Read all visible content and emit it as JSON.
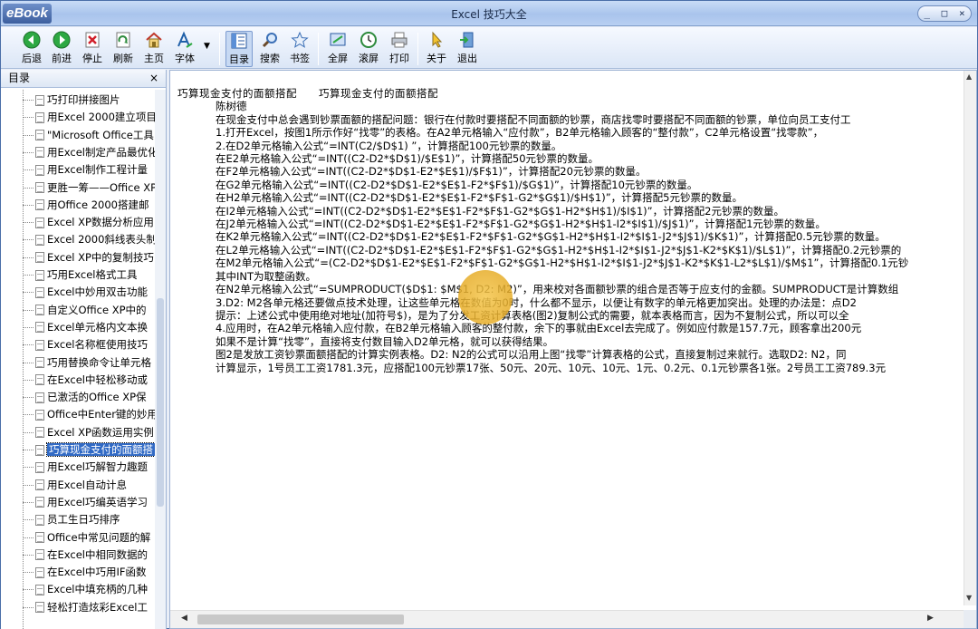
{
  "app": {
    "logo": "eBook",
    "title": "Excel 技巧大全"
  },
  "window_controls": {
    "minimize": "_",
    "maximize": "□",
    "close": "×"
  },
  "toolbar": {
    "back": "后退",
    "forward": "前进",
    "stop": "停止",
    "refresh": "刷新",
    "home": "主页",
    "font": "字体",
    "toc": "目录",
    "search": "搜索",
    "bookmark": "书签",
    "fullscreen": "全屏",
    "scroll": "滚屏",
    "print": "打印",
    "about": "关于",
    "exit": "退出"
  },
  "sidebar": {
    "title": "目录",
    "close": "×",
    "items": [
      "巧打印拼接图片",
      "用Excel 2000建立项目",
      "\"Microsoft Office工具",
      "用Excel制定产品最优化",
      "用Excel制作工程计量",
      "更胜一筹——Office XP",
      "用Office 2000搭建邮",
      "Excel XP数据分析应用",
      "Excel 2000斜线表头制",
      "Excel XP中的复制技巧",
      "巧用Excel格式工具",
      "Excel中妙用双击功能",
      "自定义Office XP中的",
      "Excel单元格内文本换",
      "Excel名称框使用技巧",
      "巧用替换命令让单元格",
      "在Excel中轻松移动或",
      "已激活的Office XP保",
      "Office中Enter键的妙用",
      "Excel XP函数运用实例",
      "巧算现金支付的面额搭",
      "用Excel巧解智力趣题",
      "用Excel自动计息",
      "用Excel巧编英语学习",
      "员工生日巧排序",
      "Office中常见问题的解",
      "在Excel中相同数据的",
      "在Excel中巧用IF函数",
      "Excel中填充柄的几种",
      "轻松打造炫彩Excel工"
    ],
    "selected_index": 20
  },
  "article": {
    "heading": "巧算现金支付的面额搭配　　巧算现金支付的面额搭配",
    "author": "陈树德",
    "lines": [
      "在现金支付中总会遇到钞票面额的搭配问题：银行在付款时要搭配不同面额的钞票，商店找零时要搭配不同面额的钞票，单位向员工支付工",
      "1.打开Excel，按图1所示作好“找零”的表格。在A2单元格输入“应付款”，B2单元格输入顾客的“整付款”，C2单元格设置“找零款”，",
      "2.在D2单元格输入公式“=INT(C2/$D$1) ”，计算搭配100元钞票的数量。",
      "在E2单元格输入公式“=INT((C2-D2*$D$1)/$E$1)”，计算搭配50元钞票的数量。",
      "在F2单元格输入公式“=INT((C2-D2*$D$1-E2*$E$1)/$F$1)”，计算搭配20元钞票的数量。",
      "在G2单元格输入公式“=INT((C2-D2*$D$1-E2*$E$1-F2*$F$1)/$G$1)”，计算搭配10元钞票的数量。",
      "在H2单元格输入公式“=INT((C2-D2*$D$1-E2*$E$1-F2*$F$1-G2*$G$1)/$H$1)”，计算搭配5元钞票的数量。",
      "在I2单元格输入公式“=INT((C2-D2*$D$1-E2*$E$1-F2*$F$1-G2*$G$1-H2*$H$1)/$I$1)”，计算搭配2元钞票的数量。",
      "在J2单元格输入公式“=INT((C2-D2*$D$1-E2*$E$1-F2*$F$1-G2*$G$1-H2*$H$1-I2*$I$1)/$J$1)”，计算搭配1元钞票的数量。",
      "在K2单元格输入公式“=INT((C2-D2*$D$1-E2*$E$1-F2*$F$1-G2*$G$1-H2*$H$1-I2*$I$1-J2*$J$1)/$K$1)”，计算搭配0.5元钞票的数量。",
      "在L2单元格输入公式“=INT((C2-D2*$D$1-E2*$E$1-F2*$F$1-G2*$G$1-H2*$H$1-I2*$I$1-J2*$J$1-K2*$K$1)/$L$1)”，计算搭配0.2元钞票的",
      "在M2单元格输入公式“=(C2-D2*$D$1-E2*$E$1-F2*$F$1-G2*$G$1-H2*$H$1-I2*$I$1-J2*$J$1-K2*$K$1-L2*$L$1)/$M$1”，计算搭配0.1元钞",
      "其中INT为取整函数。",
      "在N2单元格输入公式“=SUMPRODUCT($D$1: $M$1, D2: M2)”，用来校对各面额钞票的组合是否等于应支付的金额。SUMPRODUCT是计算数组",
      "3.D2: M2各单元格还要做点技术处理，让这些单元格在数值为0时，什么都不显示，以便让有数字的单元格更加突出。处理的办法是：点D2",
      "提示：上述公式中使用绝对地址(加符号$)，是为了分发工资计算表格(图2)复制公式的需要，就本表格而言，因为不复制公式，所以可以全",
      "4.应用时，在A2单元格输入应付款，在B2单元格输入顾客的整付款，余下的事就由Excel去完成了。例如应付款是157.7元，顾客拿出200元",
      "如果不是计算“找零”，直接将支付数目输入D2单元格，就可以获得结果。",
      "图2是发放工资钞票面额搭配的计算实例表格。D2: N2的公式可以沿用上图“找零”计算表格的公式，直接复制过来就行。选取D2: N2，同",
      "计算显示，1号员工工资1781.3元，应搭配100元钞票17张、50元、20元、10元、10元、1元、0.2元、0.1元钞票各1张。2号员工工资789.3元"
    ]
  },
  "colors": {
    "selected": "#316ac5",
    "titlebar": "#b8cff2"
  }
}
